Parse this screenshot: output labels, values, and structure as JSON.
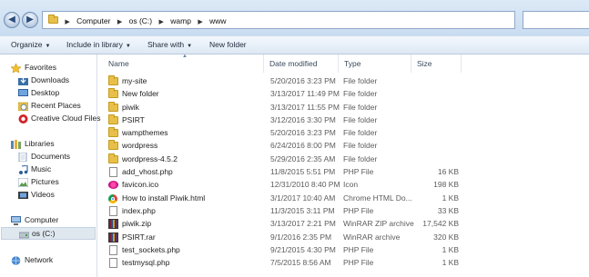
{
  "address": {
    "crumbs": [
      "Computer",
      "os (C:)",
      "wamp",
      "www"
    ]
  },
  "toolbar": {
    "organize": "Organize",
    "include_in_library": "Include in library",
    "share_with": "Share with",
    "new_folder": "New folder"
  },
  "nav": {
    "favorites": {
      "header": "Favorites",
      "items": [
        "Downloads",
        "Desktop",
        "Recent Places",
        "Creative Cloud Files"
      ]
    },
    "libraries": {
      "header": "Libraries",
      "items": [
        "Documents",
        "Music",
        "Pictures",
        "Videos"
      ]
    },
    "computer": {
      "header": "Computer",
      "items": [
        "os (C:)"
      ]
    },
    "network": "Network"
  },
  "columns": {
    "name": "Name",
    "date": "Date modified",
    "type": "Type",
    "size": "Size"
  },
  "files": [
    {
      "name": "my-site",
      "date": "5/20/2016 3:23 PM",
      "type": "File folder",
      "size": "",
      "icon": "folder"
    },
    {
      "name": "New folder",
      "date": "3/13/2017 11:49 PM",
      "type": "File folder",
      "size": "",
      "icon": "folder"
    },
    {
      "name": "piwik",
      "date": "3/13/2017 11:55 PM",
      "type": "File folder",
      "size": "",
      "icon": "folder"
    },
    {
      "name": "PSIRT",
      "date": "3/12/2016 3:30 PM",
      "type": "File folder",
      "size": "",
      "icon": "folder"
    },
    {
      "name": "wampthemes",
      "date": "5/20/2016 3:23 PM",
      "type": "File folder",
      "size": "",
      "icon": "folder"
    },
    {
      "name": "wordpress",
      "date": "6/24/2016 8:00 PM",
      "type": "File folder",
      "size": "",
      "icon": "folder"
    },
    {
      "name": "wordpress-4.5.2",
      "date": "5/29/2016 2:35 AM",
      "type": "File folder",
      "size": "",
      "icon": "folder"
    },
    {
      "name": "add_vhost.php",
      "date": "11/8/2015 5:51 PM",
      "type": "PHP File",
      "size": "16 KB",
      "icon": "php"
    },
    {
      "name": "favicon.ico",
      "date": "12/31/2010 8:40 PM",
      "type": "Icon",
      "size": "198 KB",
      "icon": "ico"
    },
    {
      "name": "How to install Piwik.html",
      "date": "3/1/2017 10:40 AM",
      "type": "Chrome HTML Do...",
      "size": "1 KB",
      "icon": "chrome"
    },
    {
      "name": "index.php",
      "date": "11/3/2015 3:11 PM",
      "type": "PHP File",
      "size": "33 KB",
      "icon": "php"
    },
    {
      "name": "piwik.zip",
      "date": "3/13/2017 2:21 PM",
      "type": "WinRAR ZIP archive",
      "size": "17,542 KB",
      "icon": "rar"
    },
    {
      "name": "PSIRT.rar",
      "date": "9/1/2016 2:35 PM",
      "type": "WinRAR archive",
      "size": "320 KB",
      "icon": "rar"
    },
    {
      "name": "test_sockets.php",
      "date": "9/21/2015 4:30 PM",
      "type": "PHP File",
      "size": "1 KB",
      "icon": "php"
    },
    {
      "name": "testmysql.php",
      "date": "7/5/2015 8:56 AM",
      "type": "PHP File",
      "size": "1 KB",
      "icon": "php"
    }
  ]
}
